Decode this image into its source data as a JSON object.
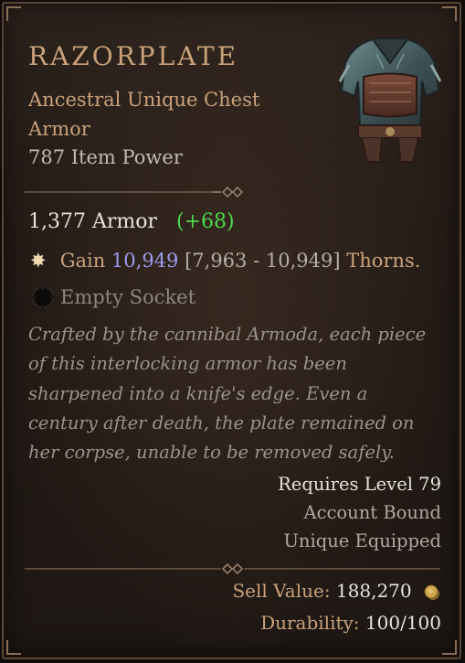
{
  "item": {
    "name": "RAZORPLATE",
    "subtitle": "Ancestral Unique Chest Armor",
    "item_power": "787 Item Power",
    "armor_value": "1,377 Armor",
    "armor_bonus": "(+68)",
    "affix": {
      "prefix": "Gain",
      "value": "10,949",
      "range": "[7,963 - 10,949]",
      "suffix": "Thorns."
    },
    "socket": "Empty Socket",
    "flavor_text": "Crafted by the cannibal Armoda, each piece of this interlocking armor has been sharpened into a knife's edge. Even a century after death, the plate remained on her corpse, unable to be removed safely.",
    "requirements": [
      "Requires Level 79",
      "Account Bound",
      "Unique Equipped"
    ],
    "sell_label": "Sell Value:",
    "sell_value": "188,270",
    "durability_label": "Durability:",
    "durability_value": "100/100"
  },
  "colors": {
    "unique_gold": "#c9a27b",
    "bonus_green": "#4dd84d",
    "affix_value_blue": "#9d9bf0",
    "flavor_gray": "#9a938b"
  },
  "icons": [
    "star-burst-icon",
    "socket-icon",
    "gold-coin-icon",
    "divider-ornament-icon"
  ]
}
